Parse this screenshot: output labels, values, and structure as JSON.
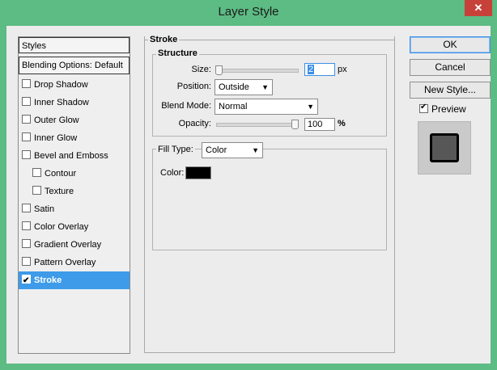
{
  "window": {
    "title": "Layer Style",
    "close_glyph": "✕"
  },
  "left_panel": {
    "styles_label": "Styles",
    "blending_label": "Blending Options: Default",
    "items": [
      {
        "label": "Drop Shadow",
        "checked": false,
        "indent": false,
        "selected": false
      },
      {
        "label": "Inner Shadow",
        "checked": false,
        "indent": false,
        "selected": false
      },
      {
        "label": "Outer Glow",
        "checked": false,
        "indent": false,
        "selected": false
      },
      {
        "label": "Inner Glow",
        "checked": false,
        "indent": false,
        "selected": false
      },
      {
        "label": "Bevel and Emboss",
        "checked": false,
        "indent": false,
        "selected": false
      },
      {
        "label": "Contour",
        "checked": false,
        "indent": true,
        "selected": false
      },
      {
        "label": "Texture",
        "checked": false,
        "indent": true,
        "selected": false
      },
      {
        "label": "Satin",
        "checked": false,
        "indent": false,
        "selected": false
      },
      {
        "label": "Color Overlay",
        "checked": false,
        "indent": false,
        "selected": false
      },
      {
        "label": "Gradient Overlay",
        "checked": false,
        "indent": false,
        "selected": false
      },
      {
        "label": "Pattern Overlay",
        "checked": false,
        "indent": false,
        "selected": false
      },
      {
        "label": "Stroke",
        "checked": true,
        "indent": false,
        "selected": true
      }
    ]
  },
  "stroke": {
    "section_title": "Stroke",
    "structure_title": "Structure",
    "size_label": "Size:",
    "size_value": "2",
    "size_unit": "px",
    "position_label": "Position:",
    "position_value": "Outside",
    "blend_mode_label": "Blend Mode:",
    "blend_mode_value": "Normal",
    "opacity_label": "Opacity:",
    "opacity_value": "100",
    "opacity_unit": "%",
    "opacity_level": 1.0,
    "size_level": 0.0,
    "fill_type_label": "Fill Type:",
    "fill_type_value": "Color",
    "color_label": "Color:",
    "color_value": "#000000"
  },
  "buttons": {
    "ok": "OK",
    "cancel": "Cancel",
    "new_style": "New Style..."
  },
  "preview": {
    "label": "Preview",
    "checked": true
  },
  "colors": {
    "title_bar": "#5dbb84",
    "selected": "#3d9be9",
    "close": "#c7413a"
  }
}
